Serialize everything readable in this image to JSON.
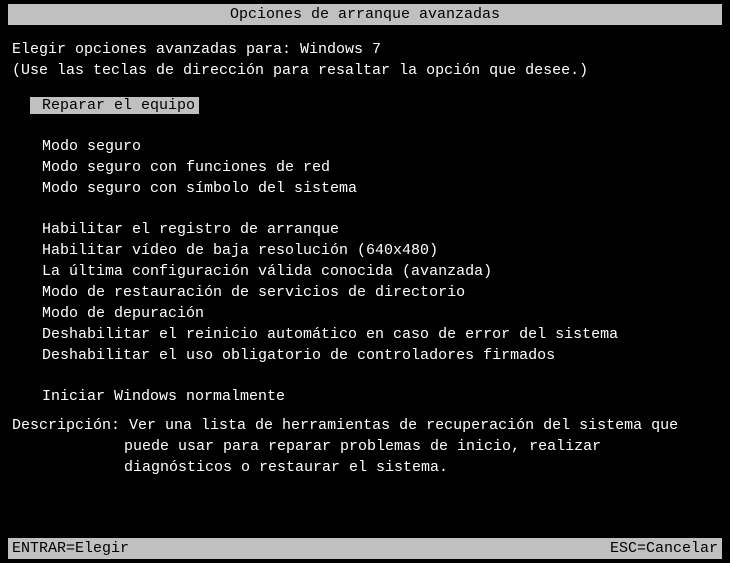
{
  "title": "Opciones de arranque avanzadas",
  "prompt_prefix": "Elegir opciones avanzadas para: ",
  "os_name": "Windows 7",
  "instruction": "(Use las teclas de dirección para resaltar la opción que desee.)",
  "menu": {
    "group1": [
      "Reparar el equipo"
    ],
    "group2": [
      "Modo seguro",
      "Modo seguro con funciones de red",
      "Modo seguro con símbolo del sistema"
    ],
    "group3": [
      "Habilitar el registro de arranque",
      "Habilitar vídeo de baja resolución (640x480)",
      "La última configuración válida conocida (avanzada)",
      "Modo de restauración de servicios de directorio",
      "Modo de depuración",
      "Deshabilitar el reinicio automático en caso de error del sistema",
      "Deshabilitar el uso obligatorio de controladores firmados"
    ],
    "group4": [
      "Iniciar Windows normalmente"
    ]
  },
  "description": {
    "label": "Descripción: ",
    "line1": "Ver una lista de herramientas de recuperación del sistema que",
    "line2": "puede usar para reparar problemas de inicio, realizar",
    "line3": "diagnósticos o restaurar el sistema."
  },
  "footer": {
    "enter": "ENTRAR=Elegir",
    "esc": "ESC=Cancelar"
  }
}
